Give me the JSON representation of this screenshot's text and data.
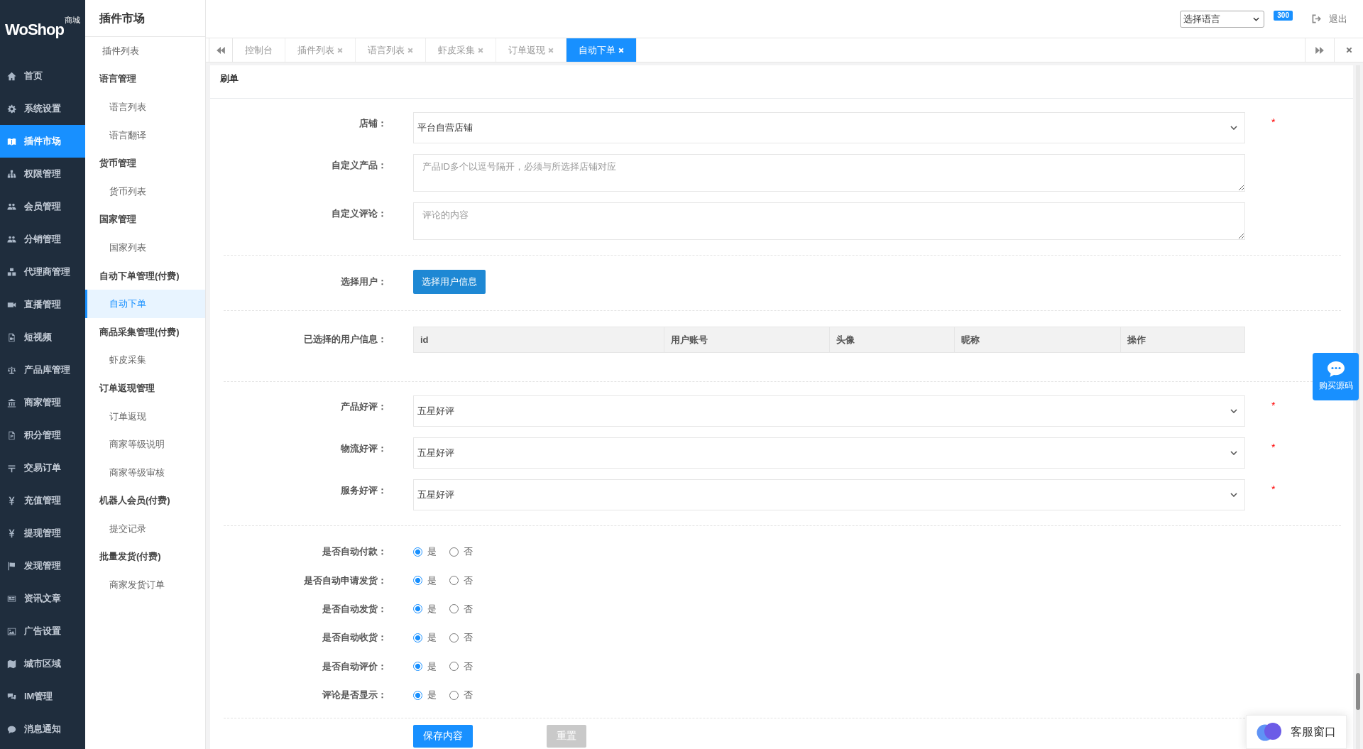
{
  "logo": {
    "text": "WoShop",
    "badge": "商城"
  },
  "sidebar": {
    "items": [
      {
        "label": "首页",
        "selected": false
      },
      {
        "label": "系统设置",
        "selected": false
      },
      {
        "label": "插件市场",
        "selected": true
      },
      {
        "label": "权限管理",
        "selected": false
      },
      {
        "label": "会员管理",
        "selected": false
      },
      {
        "label": "分销管理",
        "selected": false
      },
      {
        "label": "代理商管理",
        "selected": false
      },
      {
        "label": "直播管理",
        "selected": false
      },
      {
        "label": "短视频",
        "selected": false
      },
      {
        "label": "产品库管理",
        "selected": false
      },
      {
        "label": "商家管理",
        "selected": false
      },
      {
        "label": "积分管理",
        "selected": false
      },
      {
        "label": "交易订单",
        "selected": false
      },
      {
        "label": "充值管理",
        "selected": false
      },
      {
        "label": "提现管理",
        "selected": false
      },
      {
        "label": "发现管理",
        "selected": false
      },
      {
        "label": "资讯文章",
        "selected": false
      },
      {
        "label": "广告设置",
        "selected": false
      },
      {
        "label": "城市区域",
        "selected": false
      },
      {
        "label": "IM管理",
        "selected": false
      },
      {
        "label": "消息通知",
        "selected": false
      }
    ]
  },
  "submenu": {
    "title": "插件市场",
    "items": [
      {
        "kind": "link",
        "label": "插件列表",
        "selected": false
      },
      {
        "kind": "group",
        "label": "语言管理",
        "children": [
          {
            "label": "语言列表",
            "selected": false
          },
          {
            "label": "语言翻译",
            "selected": false
          }
        ]
      },
      {
        "kind": "group",
        "label": "货币管理",
        "children": [
          {
            "label": "货币列表",
            "selected": false
          }
        ]
      },
      {
        "kind": "group",
        "label": "国家管理",
        "children": [
          {
            "label": "国家列表",
            "selected": false
          }
        ]
      },
      {
        "kind": "group",
        "label": "自动下单管理(付费)",
        "children": [
          {
            "label": "自动下单",
            "selected": true
          }
        ]
      },
      {
        "kind": "group",
        "label": "商品采集管理(付费)",
        "children": [
          {
            "label": "虾皮采集",
            "selected": false
          }
        ]
      },
      {
        "kind": "group",
        "label": "订单返现管理",
        "children": [
          {
            "label": "订单返现",
            "selected": false
          },
          {
            "label": "商家等级说明",
            "selected": false
          },
          {
            "label": "商家等级审核",
            "selected": false
          }
        ]
      },
      {
        "kind": "group",
        "label": "机器人会员(付费)",
        "children": [
          {
            "label": "提交记录",
            "selected": false
          }
        ]
      },
      {
        "kind": "group",
        "label": "批量发货(付费)",
        "children": [
          {
            "label": "商家发货订单",
            "selected": false
          }
        ]
      }
    ]
  },
  "topbar": {
    "language_select": {
      "value": "选择语言"
    },
    "notifications": {
      "badge": "300"
    },
    "logout": {
      "label": "退出"
    }
  },
  "tabs": [
    {
      "label": "控制台",
      "closable": false,
      "selected": false
    },
    {
      "label": "插件列表",
      "closable": true,
      "selected": false
    },
    {
      "label": "语言列表",
      "closable": true,
      "selected": false
    },
    {
      "label": "虾皮采集",
      "closable": true,
      "selected": false
    },
    {
      "label": "订单返现",
      "closable": true,
      "selected": false
    },
    {
      "label": "自动下单",
      "closable": true,
      "selected": true
    }
  ],
  "panel": {
    "title": "刷单",
    "sections": [
      {
        "fields": [
          {
            "kind": "select",
            "label": "店铺：",
            "value": "平台自营店铺",
            "required_mark": "*"
          },
          {
            "kind": "textarea",
            "label": "自定义产品：",
            "placeholder": "产品ID多个以逗号隔开，必须与所选择店铺对应"
          },
          {
            "kind": "textarea",
            "label": "自定义评论：",
            "placeholder": "评论的内容"
          }
        ]
      },
      {
        "fields": [
          {
            "kind": "button",
            "label": "选择用户：",
            "button": "选择用户信息"
          }
        ]
      },
      {
        "fields": [
          {
            "kind": "table",
            "label": "已选择的用户信息：",
            "columns": [
              "id",
              "用户账号",
              "头像",
              "昵称",
              "操作"
            ]
          }
        ]
      },
      {
        "fields": [
          {
            "kind": "select",
            "label": "产品好评：",
            "value": "五星好评",
            "required_mark": "*"
          },
          {
            "kind": "select",
            "label": "物流好评：",
            "value": "五星好评",
            "required_mark": "*"
          },
          {
            "kind": "select",
            "label": "服务好评：",
            "value": "五星好评",
            "required_mark": "*"
          }
        ]
      },
      {
        "fields": [
          {
            "kind": "radio",
            "label": "是否自动付款：",
            "options": [
              {
                "label": "是",
                "selected": true
              },
              {
                "label": "否",
                "selected": false
              }
            ]
          },
          {
            "kind": "radio",
            "label": "是否自动申请发货：",
            "options": [
              {
                "label": "是",
                "selected": true
              },
              {
                "label": "否",
                "selected": false
              }
            ]
          },
          {
            "kind": "radio",
            "label": "是否自动发货：",
            "options": [
              {
                "label": "是",
                "selected": true
              },
              {
                "label": "否",
                "selected": false
              }
            ]
          },
          {
            "kind": "radio",
            "label": "是否自动收货：",
            "options": [
              {
                "label": "是",
                "selected": true
              },
              {
                "label": "否",
                "selected": false
              }
            ]
          },
          {
            "kind": "radio",
            "label": "是否自动评价：",
            "options": [
              {
                "label": "是",
                "selected": true
              },
              {
                "label": "否",
                "selected": false
              }
            ]
          },
          {
            "kind": "radio",
            "label": "评论是否显示：",
            "options": [
              {
                "label": "是",
                "selected": true
              },
              {
                "label": "否",
                "selected": false
              }
            ]
          }
        ]
      },
      {
        "fields": [
          {
            "kind": "actions",
            "buttons": [
              {
                "label": "保存内容",
                "kind": "primary"
              },
              {
                "label": "重置",
                "kind": "secondary"
              }
            ]
          }
        ]
      }
    ]
  },
  "floating": {
    "buy_source": {
      "label": "购买源码"
    },
    "customer_service": {
      "label": "客服窗口"
    }
  }
}
